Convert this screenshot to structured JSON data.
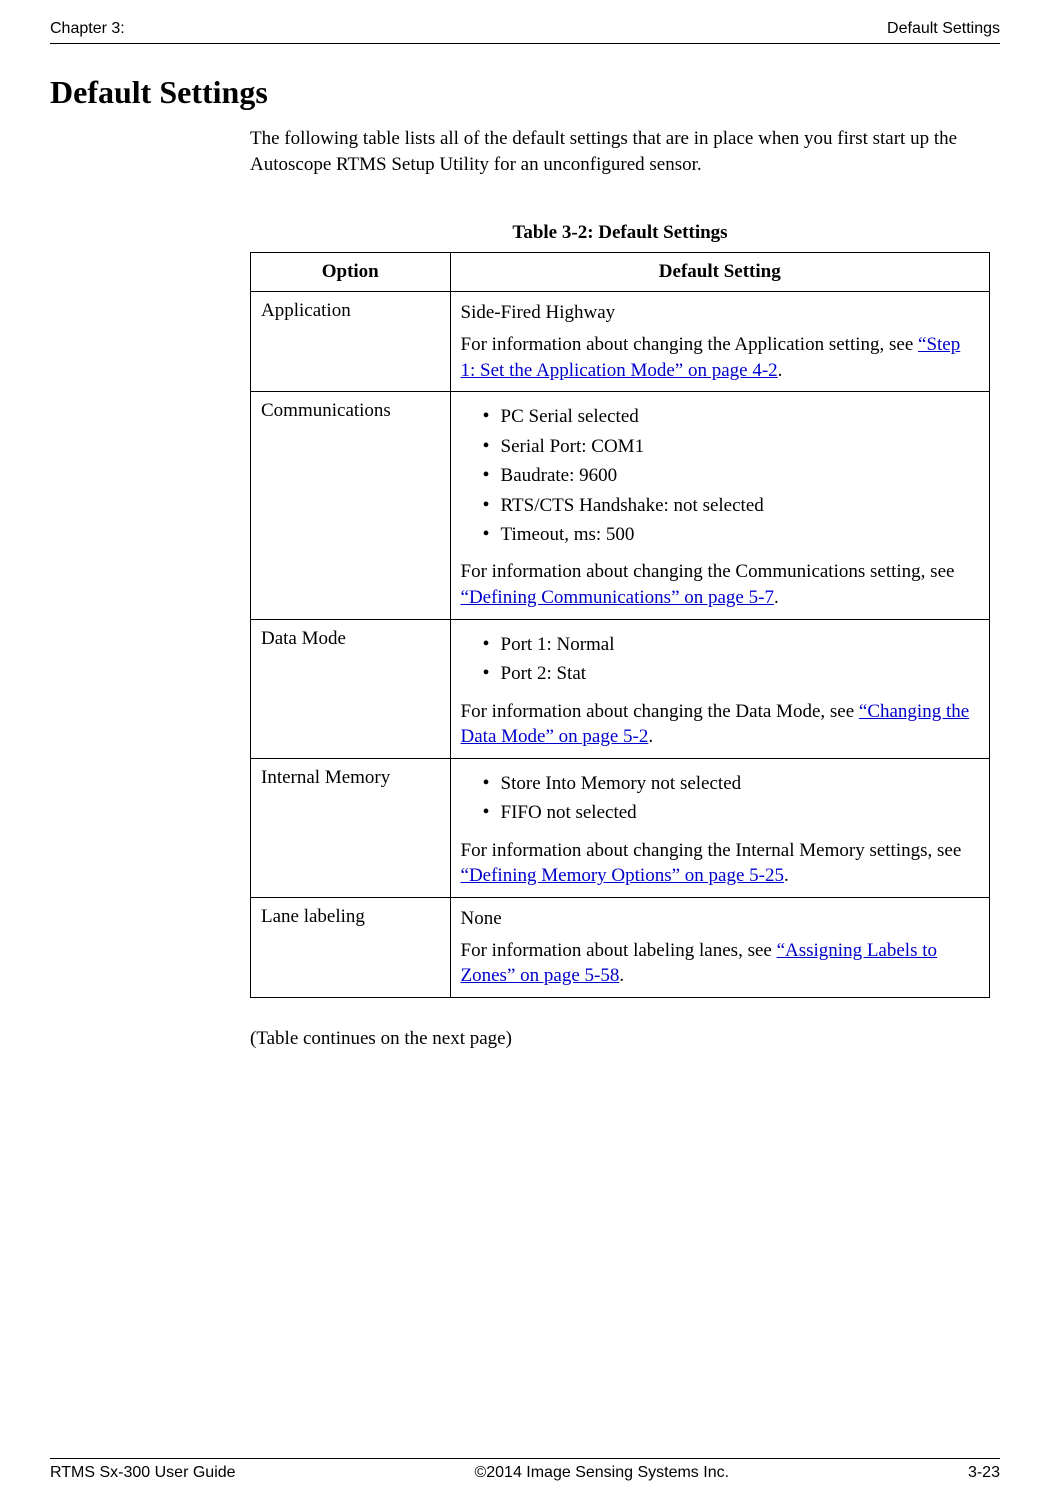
{
  "header": {
    "left": "Chapter 3:",
    "right": "Default Settings"
  },
  "title": "Default Settings",
  "intro": "The following table lists all of the default settings that are in place when you first start up the Autoscope RTMS Setup Utility for an unconfigured sensor.",
  "table": {
    "caption": "Table 3-2: Default Settings",
    "columns": {
      "option": "Option",
      "default": "Default Setting"
    },
    "rows": {
      "application": {
        "option": "Application",
        "line1": "Side-Fired Highway",
        "info_prefix": "For information about changing the Application setting, see ",
        "link": "“Step 1: Set the Application Mode” on page 4-2",
        "info_suffix": "."
      },
      "communications": {
        "option": "Communications",
        "bullets": [
          "PC Serial selected",
          "Serial Port: COM1",
          "Baudrate: 9600",
          "RTS/CTS Handshake: not selected",
          "Timeout, ms: 500"
        ],
        "info_prefix": "For information about changing the Communications setting, see ",
        "link": "“Defining Communications” on page 5-7",
        "info_suffix": "."
      },
      "datamode": {
        "option": "Data Mode",
        "bullets": [
          "Port 1: Normal",
          "Port 2: Stat"
        ],
        "info_prefix": "For information about changing the Data Mode, see ",
        "link": "“Changing the Data Mode” on page 5-2",
        "info_suffix": "."
      },
      "memory": {
        "option": "Internal Memory",
        "bullets": [
          "Store Into Memory not selected",
          "FIFO not selected"
        ],
        "info_prefix": "For information about changing the Internal Memory settings, see ",
        "link": "“Defining Memory Options” on page 5-25",
        "info_suffix": "."
      },
      "lane": {
        "option": "Lane labeling",
        "line1": "None",
        "info_prefix": "For information about labeling lanes, see ",
        "link": "“Assigning Labels to Zones” on page 5-58",
        "info_suffix": "."
      }
    }
  },
  "continues": "(Table continues on the next page)",
  "footer": {
    "left": "RTMS Sx-300 User Guide",
    "center": "©2014 Image Sensing Systems Inc.",
    "right": "3-23"
  }
}
